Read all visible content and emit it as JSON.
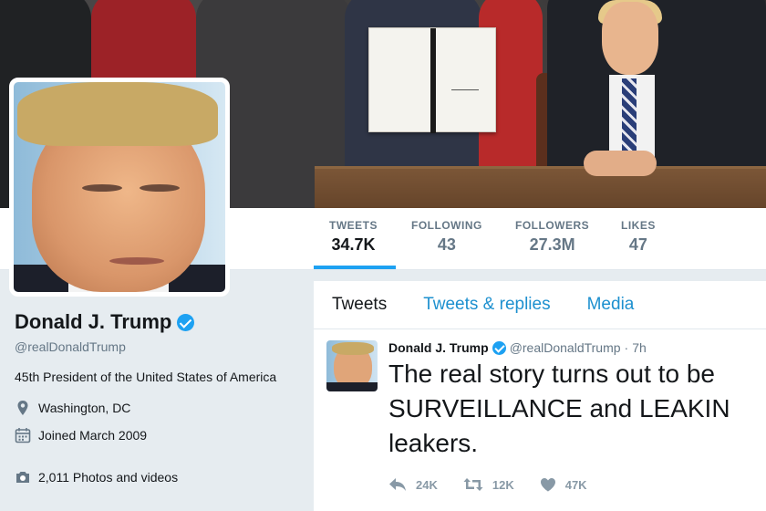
{
  "nav": {
    "stats": [
      {
        "label": "TWEETS",
        "value": "34.7K"
      },
      {
        "label": "FOLLOWING",
        "value": "43"
      },
      {
        "label": "FOLLOWERS",
        "value": "27.3M"
      },
      {
        "label": "LIKES",
        "value": "47"
      }
    ],
    "active_stat": "TWEETS"
  },
  "profile": {
    "name": "Donald J. Trump",
    "handle": "@realDonaldTrump",
    "bio": "45th President of the United States of America",
    "location": "Washington, DC",
    "joined": "Joined March 2009",
    "photos": "2,011 Photos and videos",
    "verified": true
  },
  "feed": {
    "tabs": [
      "Tweets",
      "Tweets & replies",
      "Media"
    ],
    "tweet": {
      "name": "Donald J. Trump",
      "handle": "@realDonaldTrump",
      "dot": "·",
      "time": "7h",
      "text_lines": [
        "The real story turns out to be",
        "SURVEILLANCE and LEAKIN",
        "leakers."
      ],
      "reply_count": "24K",
      "retweet_count": "12K",
      "like_count": "47K"
    }
  },
  "icons": {
    "location": "map-pin-icon",
    "joined": "calendar-icon",
    "photos": "camera-icon",
    "verified": "verified-badge-icon",
    "reply": "reply-icon",
    "retweet": "retweet-icon",
    "like": "heart-icon"
  },
  "colors": {
    "accent": "#1da1f2",
    "link": "#1d90cf",
    "muted": "#657786",
    "page_bg": "#e6ecf0"
  }
}
